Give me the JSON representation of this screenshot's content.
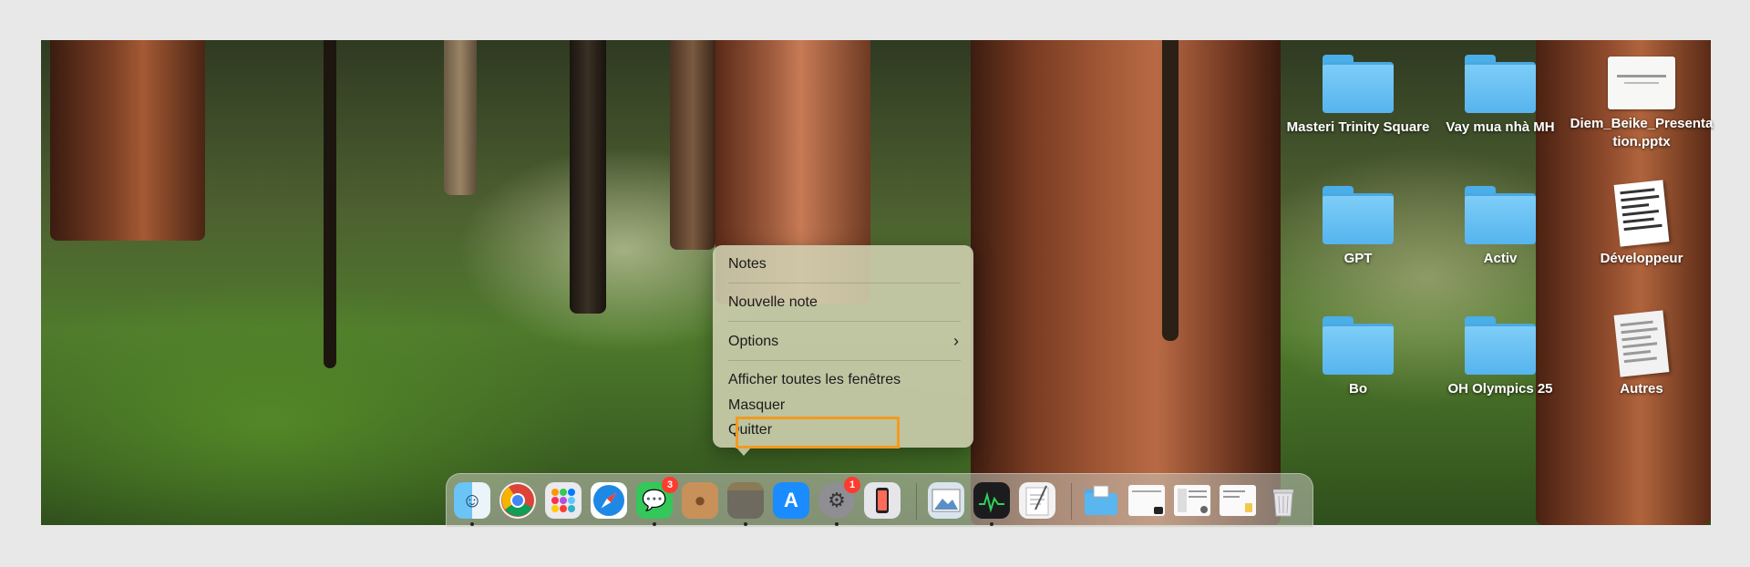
{
  "desktop": {
    "icons": [
      {
        "label": "Masteri Trinity Square",
        "type": "folder"
      },
      {
        "label": "Vay mua nhà MH",
        "type": "folder"
      },
      {
        "label": "Diem_Beike_Presentation.pptx",
        "type": "presentation"
      },
      {
        "label": "GPT",
        "type": "folder"
      },
      {
        "label": "Activ",
        "type": "folder"
      },
      {
        "label": "Développeur",
        "type": "document"
      },
      {
        "label": "Bo",
        "type": "folder"
      },
      {
        "label": "OH Olympics 25",
        "type": "folder"
      },
      {
        "label": "Autres",
        "type": "document"
      }
    ]
  },
  "context_menu": {
    "title": "Notes",
    "items": [
      "Nouvelle note",
      "Options",
      "Afficher toutes les fenêtres",
      "Masquer",
      "Quitter"
    ],
    "submenu_chevron": "›"
  },
  "dock": {
    "apps": [
      {
        "name": "finder-icon",
        "badge": ""
      },
      {
        "name": "chrome-icon",
        "badge": ""
      },
      {
        "name": "launchpad-icon",
        "badge": ""
      },
      {
        "name": "safari-icon",
        "badge": ""
      },
      {
        "name": "messages-icon",
        "badge": "3"
      },
      {
        "name": "contacts-icon",
        "badge": ""
      },
      {
        "name": "notes-icon",
        "badge": ""
      },
      {
        "name": "app-store-icon",
        "badge": ""
      },
      {
        "name": "system-settings-icon",
        "badge": "1"
      },
      {
        "name": "iphone-mirroring-icon",
        "badge": ""
      },
      {
        "name": "preview-icon",
        "badge": ""
      },
      {
        "name": "activity-monitor-icon",
        "badge": ""
      },
      {
        "name": "textedit-icon",
        "badge": ""
      },
      {
        "name": "downloads-folder-icon",
        "badge": ""
      },
      {
        "name": "recent-window-1-icon",
        "badge": ""
      },
      {
        "name": "recent-window-2-icon",
        "badge": ""
      },
      {
        "name": "recent-window-3-icon",
        "badge": ""
      },
      {
        "name": "trash-icon",
        "badge": ""
      }
    ]
  },
  "colors": {
    "highlight": "#f39a1e",
    "folder": "#56b4ee",
    "badge": "#ff3b30"
  }
}
